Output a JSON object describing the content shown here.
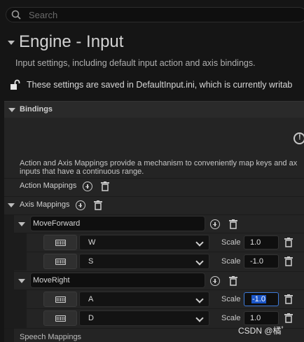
{
  "search": {
    "placeholder": "Search",
    "icon": "search-icon"
  },
  "header": {
    "title": "Engine - Input",
    "subtitle": "Input settings, including default input action and axis bindings.",
    "saved_notice": "These settings are saved in DefaultInput.ini, which is currently writab"
  },
  "bindings": {
    "section_label": "Bindings",
    "description_line1": "Action and Axis Mappings provide a mechanism to conveniently map keys and ax",
    "description_line2": "inputs that have a continuous range.",
    "action_mappings_label": "Action Mappings",
    "axis_mappings_label": "Axis Mappings",
    "speech_mappings_label": "Speech Mappings",
    "scale_label": "Scale",
    "axes": [
      {
        "name": "MoveForward",
        "keys": [
          {
            "key": "W",
            "scale": "1.0"
          },
          {
            "key": "S",
            "scale": "-1.0"
          }
        ]
      },
      {
        "name": "MoveRight",
        "keys": [
          {
            "key": "A",
            "scale": "-1.0"
          },
          {
            "key": "D",
            "scale": "1.0"
          }
        ]
      }
    ]
  },
  "watermark": "CSDN @橘ﾟ",
  "colors": {
    "accent": "#1b56c9",
    "background": "#242424"
  }
}
